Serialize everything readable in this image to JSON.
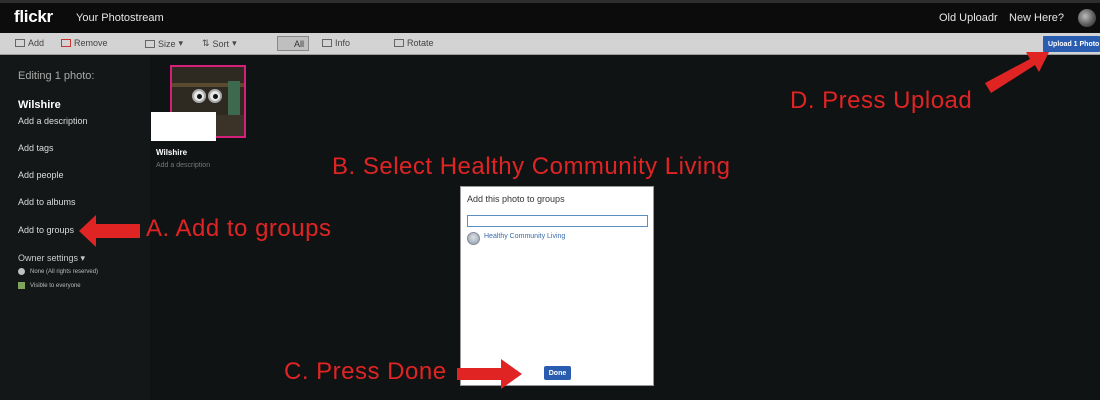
{
  "header": {
    "logo": "flickr",
    "title": "Your Photostream",
    "links": [
      "Old Uploadr",
      "New Here?"
    ]
  },
  "toolbar": {
    "add": "Add",
    "remove": "Remove",
    "size": "Size",
    "sort": "Sort",
    "all": "All",
    "info": "Info",
    "rotate": "Rotate",
    "upload": "Upload 1 Photo"
  },
  "sidebar": {
    "editing": "Editing 1 photo:",
    "title": "Wilshire",
    "items": [
      "Add a description",
      "Add tags",
      "Add people",
      "Add to albums",
      "Add to groups"
    ],
    "owner_settings": "Owner settings",
    "owner_chevron": "▾",
    "license": "None (All rights reserved)",
    "visibility": "Visible to everyone"
  },
  "photo": {
    "title": "Wilshire",
    "description_placeholder": "Add a description"
  },
  "dialog": {
    "title": "Add this photo to groups",
    "search_value": "",
    "groups": [
      "Healthy Community Living"
    ],
    "done": "Done"
  },
  "annotations": {
    "a": "A. Add to groups",
    "b": "B. Select Healthy Community Living",
    "c": "C. Press Done",
    "d": "D. Press Upload"
  },
  "colors": {
    "annotation": "#e02424",
    "accent": "#2a5db0",
    "photo_border": "#d61f7a"
  }
}
